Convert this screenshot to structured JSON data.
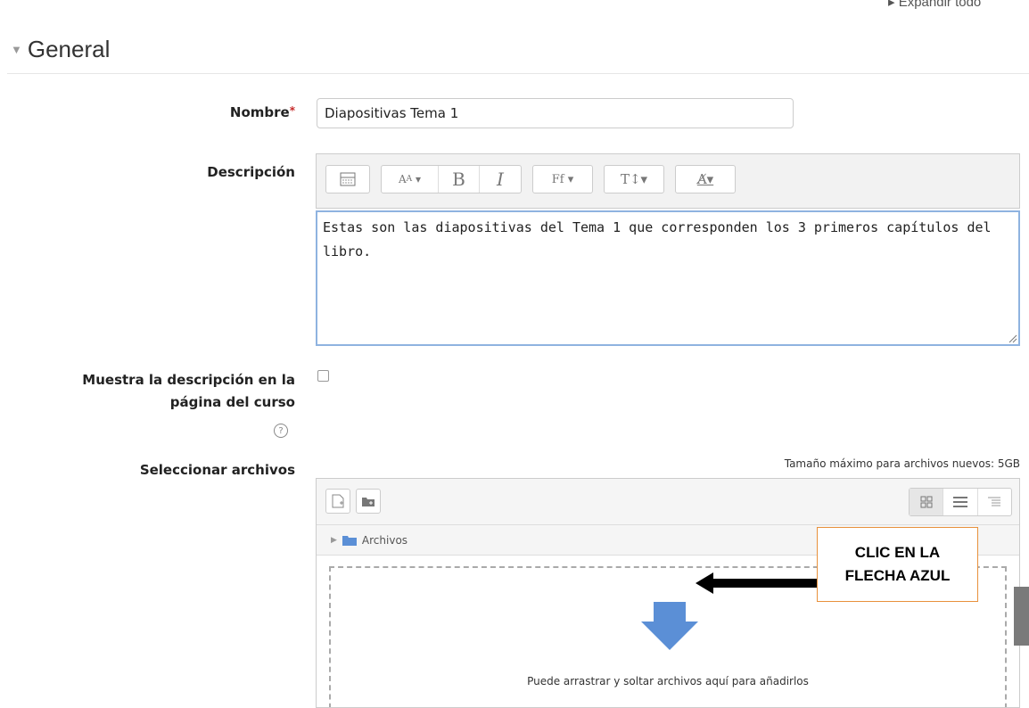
{
  "header": {
    "expand_all": "▸ Expandir todo",
    "section_title": "General"
  },
  "form": {
    "name_label": "Nombre",
    "required_mark": "*",
    "name_value": "Diapositivas Tema 1",
    "description_label": "Descripción",
    "description_text": "Estas son las diapositivas del Tema 1 que corresponden los 3 primeros capítulos del libro.",
    "show_description_label_line1": "Muestra la descripción en la",
    "show_description_label_line2": "página del curso",
    "show_description_checked": false,
    "help_icon_glyph": "?",
    "files_label": "Seleccionar archivos",
    "max_size_text": "Tamaño máximo para archivos nuevos: 5GB"
  },
  "editor_toolbar": {
    "icons": [
      "toolbar-toggle-icon",
      "style-icon",
      "bold-icon",
      "italic-icon",
      "font-icon",
      "text-size-icon",
      "clear-format-icon"
    ],
    "labels": {
      "bold": "B",
      "italic": "I"
    }
  },
  "filepicker": {
    "path_label": "Archivos",
    "drop_text": "Puede arrastrar y soltar archivos aquí para añadirlos",
    "view_modes": [
      "icons-view",
      "list-view",
      "tree-view"
    ],
    "active_view": "icons-view"
  },
  "annotation": {
    "line1": "CLIC EN LA",
    "line2": "FLECHA AZUL",
    "border_color": "#e8913c"
  },
  "colors": {
    "accent_blue": "#5b8fd6",
    "editor_focus": "#8fb3e0",
    "required_red": "#c62828"
  }
}
